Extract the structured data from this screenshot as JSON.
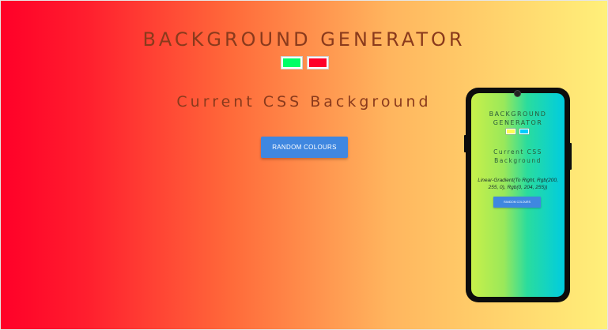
{
  "page": {
    "title": "BACKGROUND GENERATOR",
    "color1": "#00ff66",
    "color2": "#ff0028",
    "subtitle": "Current CSS Background",
    "css_value": "",
    "random_button": "RANDOM COLOURS",
    "gradient": {
      "direction": "to right",
      "colors": [
        "#ff0028",
        "#fff07a"
      ]
    }
  },
  "mobile_preview": {
    "title": "BACKGROUND GENERATOR",
    "color1": "#ffff55",
    "color2": "#00ccff",
    "subtitle": "Current CSS Background",
    "css_value": "Linear-Gradient(To Right, Rgb(200, 255, 0), Rgb(0, 204, 255))",
    "random_button": "RANDOM COLOURS"
  }
}
